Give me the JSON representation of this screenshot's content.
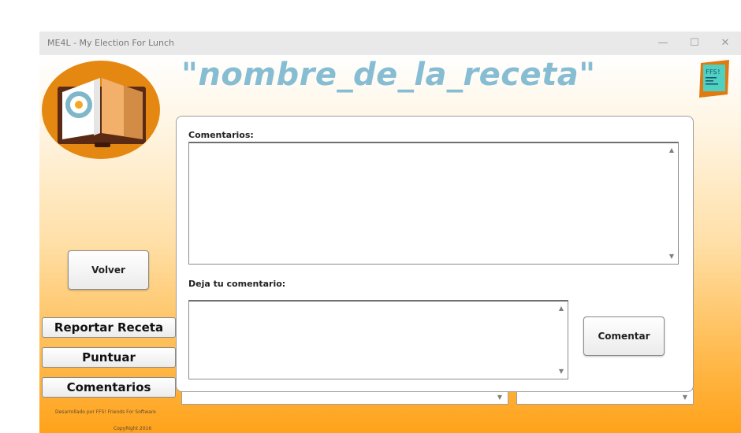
{
  "window": {
    "title": "ME4L - My Election For Lunch",
    "controls": {
      "minimize": "—",
      "maximize": "☐",
      "close": "✕"
    }
  },
  "header": {
    "recipe_title": "\"nombre_de_la_receta\"",
    "logo_icon": "open-book-icon",
    "badge_text": "FFS!"
  },
  "comments": {
    "label": "Comentarios:",
    "value": ""
  },
  "new_comment": {
    "label": "Deja tu comentario:",
    "value": ""
  },
  "buttons": {
    "volver": "Volver",
    "comentar": "Comentar"
  },
  "sidebar": {
    "items": [
      {
        "label": "Reportar Receta"
      },
      {
        "label": "Puntuar"
      },
      {
        "label": "Comentarios"
      }
    ]
  },
  "combos": [
    {
      "value": ""
    },
    {
      "value": ""
    }
  ],
  "footer": {
    "credit": "Desarrollado por FFS! Friends For Software",
    "copyright": "CopyRight 2016"
  },
  "colors": {
    "title_text": "#86bdd3",
    "gradient_bottom": "#ffa21a",
    "logo_circle": "#e48812",
    "badge_bg": "#4fd1c1"
  }
}
